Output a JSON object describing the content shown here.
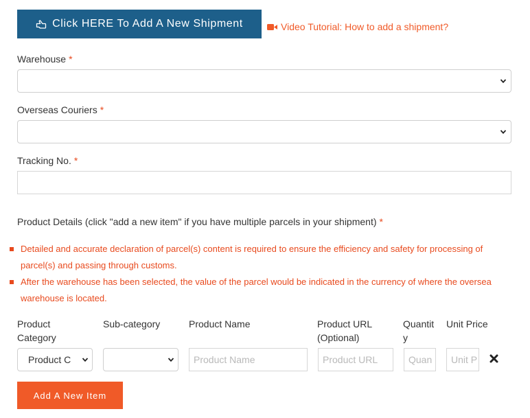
{
  "header": {
    "add_shipment_label": "Click HERE To Add A New Shipment",
    "video_tutorial_label": "Video Tutorial: How to add a shipment?"
  },
  "form": {
    "warehouse_label": "Warehouse",
    "overseas_couriers_label": "Overseas Couriers",
    "tracking_label": "Tracking No.",
    "required_mark": "*",
    "product_details_label": "Product Details (click \"add a new item\" if you have multiple parcels in your shipment)"
  },
  "notes": [
    "Detailed and accurate declaration of parcel(s) content is required to ensure the efficiency and safety for processing of parcel(s) and passing through customs.",
    "After the warehouse has been selected, the value of the parcel would be indicated in the currency of where the oversea warehouse is located."
  ],
  "table": {
    "headers": {
      "category": "Product Category",
      "subcategory": "Sub-category",
      "name": "Product Name",
      "url": "Product URL (Optional)",
      "quantity": "Quantity",
      "unit_price": "Unit Price"
    },
    "row": {
      "category_value": "Product C",
      "name_placeholder": "Product Name",
      "url_placeholder": "Product URL",
      "quantity_placeholder": "Quan",
      "unit_price_placeholder": "Unit P"
    }
  },
  "actions": {
    "add_item_label": "Add A New Item"
  },
  "colors": {
    "primary": "#1d5f8a",
    "accent": "#f05a28",
    "required": "#e84a1e"
  },
  "icons": {
    "add_button": "hand-pointer-icon",
    "video_link": "video-camera-icon",
    "remove_row": "close-icon",
    "select": "chevron-down-icon"
  }
}
